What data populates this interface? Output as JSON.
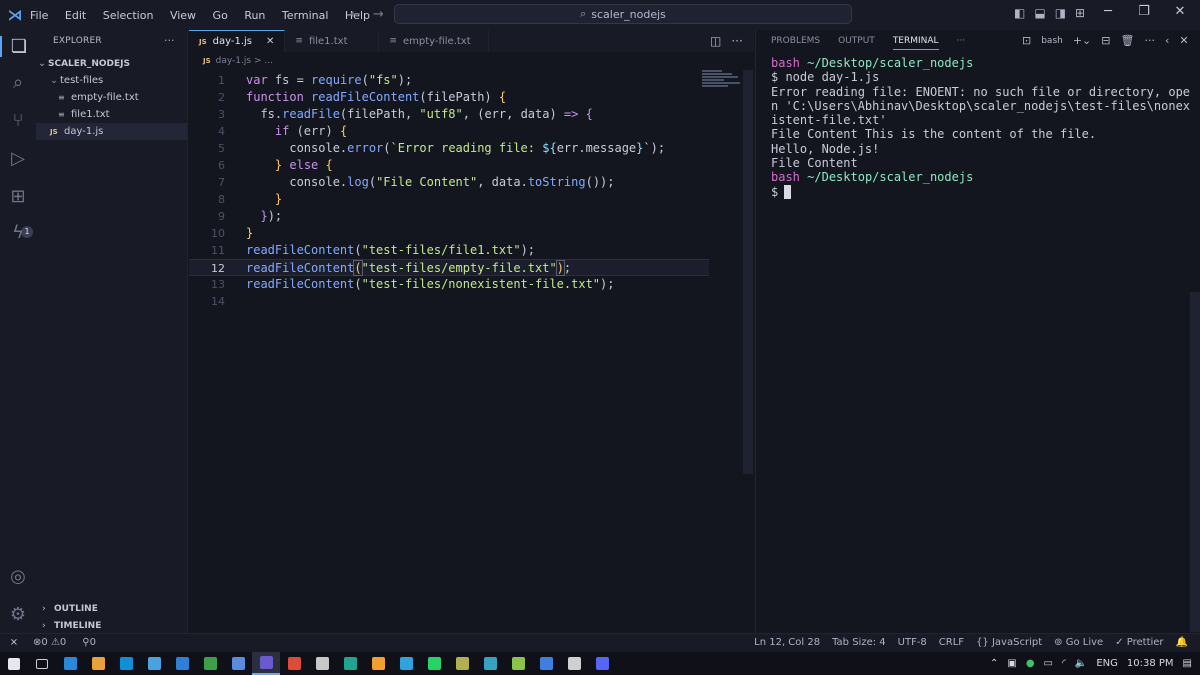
{
  "titlebar": {
    "menu": [
      "File",
      "Edit",
      "Selection",
      "View",
      "Go",
      "Run",
      "Terminal",
      "Help"
    ],
    "search": "scaler_nodejs"
  },
  "sidebar": {
    "header": "EXPLORER",
    "root": "SCALER_NODEJS",
    "folder": "test-files",
    "files": [
      "empty-file.txt",
      "file1.txt"
    ],
    "active_file": "day-1.js",
    "outline": "OUTLINE",
    "timeline": "TIMELINE",
    "extensions_badge": "1"
  },
  "tabs": [
    {
      "label": "day-1.js",
      "active": true
    },
    {
      "label": "file1.txt",
      "active": false
    },
    {
      "label": "empty-file.txt",
      "active": false
    }
  ],
  "breadcrumb": {
    "file": "day-1.js",
    "rest": "> ..."
  },
  "editor": {
    "line_numbers": [
      "1",
      "2",
      "3",
      "4",
      "5",
      "6",
      "7",
      "8",
      "9",
      "10",
      "11",
      "12",
      "13",
      "14"
    ],
    "current_line": 12
  },
  "panel": {
    "tabs": [
      "PROBLEMS",
      "OUTPUT",
      "TERMINAL"
    ],
    "shell": "bash",
    "terminal": {
      "prompt1_user": "bash",
      "prompt1_path": "~/Desktop/scaler_nodejs",
      "command": "$ node day-1.js",
      "output": [
        "Error reading file: ENOENT: no such file or directory, open 'C:\\Users\\Abhinav\\Desktop\\scaler_nodejs\\test-files\\nonexistent-file.txt'",
        "File Content This is the content of the file.",
        "Hello, Node.js!",
        "File Content"
      ],
      "prompt2_user": "bash",
      "prompt2_path": "~/Desktop/scaler_nodejs",
      "final_prompt": "$"
    }
  },
  "statusbar": {
    "errors": "0",
    "warnings": "0",
    "ports": "0",
    "position": "Ln 12, Col 28",
    "tab_size": "Tab Size: 4",
    "encoding": "UTF-8",
    "eol": "CRLF",
    "language": "JavaScript",
    "golive": "Go Live",
    "prettier": "Prettier"
  },
  "taskbar": {
    "language": "ENG",
    "time": "10:38 PM",
    "app_colors": [
      "#2b88d8",
      "#e8a33c",
      "#0f8fd6",
      "#4aa3df",
      "#2f7fd8",
      "#3e9f4a",
      "#5a8bdc",
      "#6a5acd",
      "#dd4b39",
      "#c8c8c8",
      "#1fa58f",
      "#f0a030",
      "#2ea3dd",
      "#25d366",
      "#b0b050",
      "#38a0c0",
      "#8bc34a",
      "#3f7fe0",
      "#d0d0d0",
      "#5865f2"
    ]
  }
}
